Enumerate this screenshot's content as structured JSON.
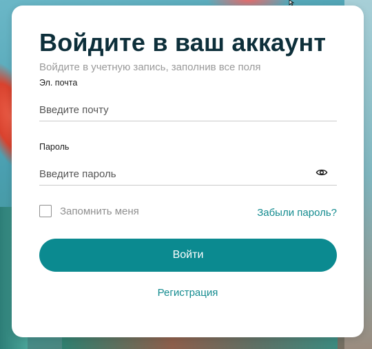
{
  "login_form": {
    "title": "Войдите в ваш аккаунт",
    "subtitle": "Войдите в учетную запись, заполнив все поля",
    "email": {
      "label": "Эл. почта",
      "placeholder": "Введите почту",
      "value": ""
    },
    "password": {
      "label": "Пароль",
      "placeholder": "Введите пароль",
      "value": "",
      "toggle_icon": "eye-icon"
    },
    "remember_me": {
      "label": "Запомнить меня",
      "checked": false
    },
    "forgot_password_label": "Забыли пароль?",
    "submit_label": "Войти",
    "register_label": "Регистрация"
  },
  "colors": {
    "accent": "#0b8a90",
    "link": "#138b8f",
    "title": "#0d2f3a",
    "muted": "#9a9a9a"
  }
}
